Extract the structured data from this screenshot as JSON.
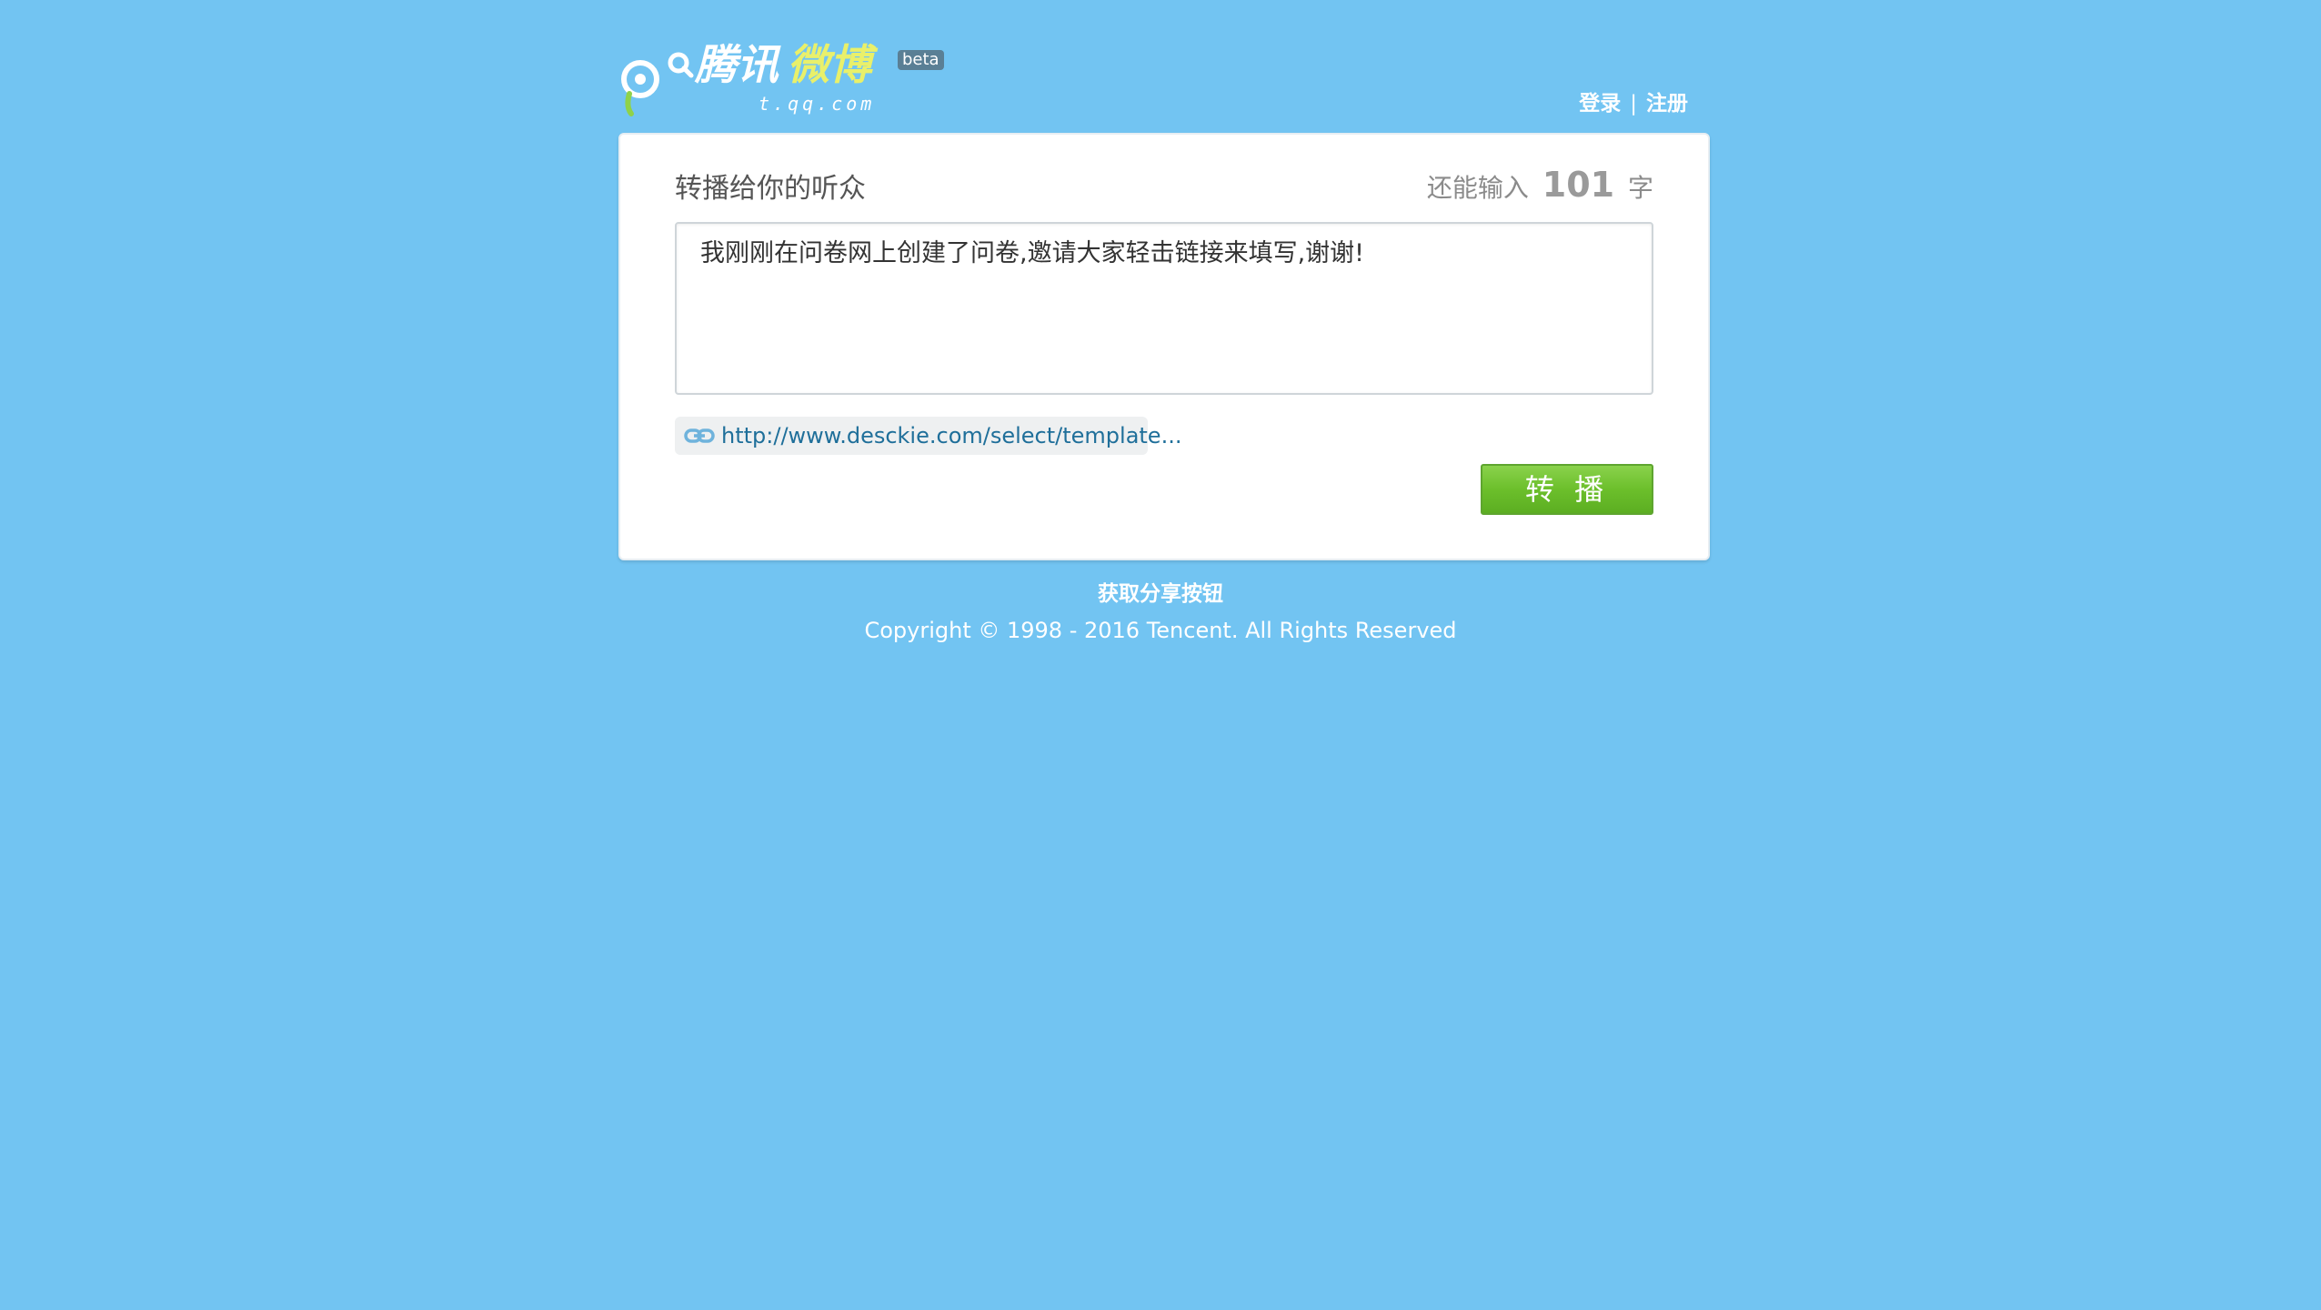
{
  "header": {
    "logo_text": "腾讯微博",
    "logo_domain": "t.qq.com",
    "beta_label": "beta",
    "login_label": "登录",
    "separator": "|",
    "register_label": "注册"
  },
  "share_box": {
    "title": "转播给你的听众",
    "remaining_prefix": "还能输入",
    "remaining_count": "101",
    "remaining_suffix": "字",
    "message": "我刚刚在问卷网上创建了问卷,邀请大家轻击链接来填写,谢谢!",
    "link_url": "http://www.desckie.com/select/template...",
    "submit_label": "转 播"
  },
  "footer": {
    "get_button_link": "获取分享按钮",
    "copyright": "Copyright © 1998 - 2016 Tencent. All Rights Reserved"
  },
  "colors": {
    "background": "#72c4f2",
    "button_green": "#6cbf2b",
    "link_blue": "#1f6f9a",
    "logo_yellow": "#e9f06a"
  }
}
